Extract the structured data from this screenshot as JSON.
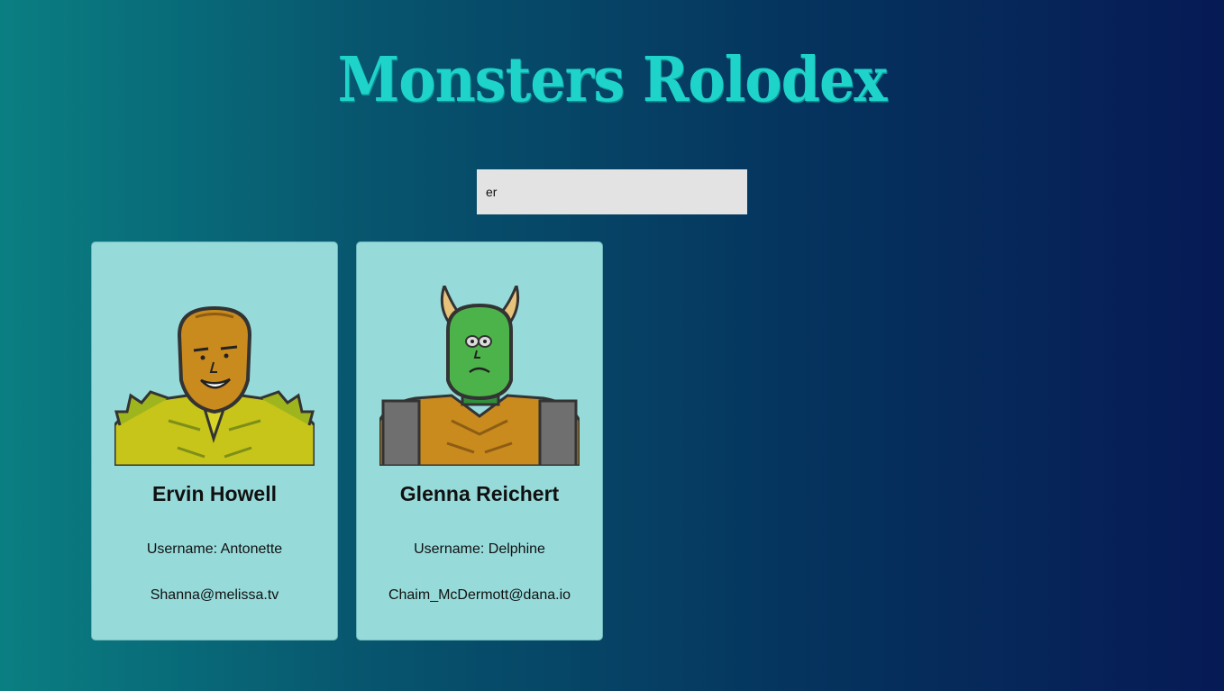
{
  "app": {
    "title": "Monsters Rolodex"
  },
  "search": {
    "value": "er",
    "placeholder": ""
  },
  "monsters": [
    {
      "name": "Ervin Howell",
      "username_label": "Username: Antonette",
      "email": "Shanna@melissa.tv"
    },
    {
      "name": "Glenna Reichert",
      "username_label": "Username: Delphine",
      "email": "Chaim_McDermott@dana.io"
    }
  ],
  "colors": {
    "title": "#1ed3c9",
    "card_bg": "#97dada",
    "search_bg": "#e3e3e3"
  }
}
